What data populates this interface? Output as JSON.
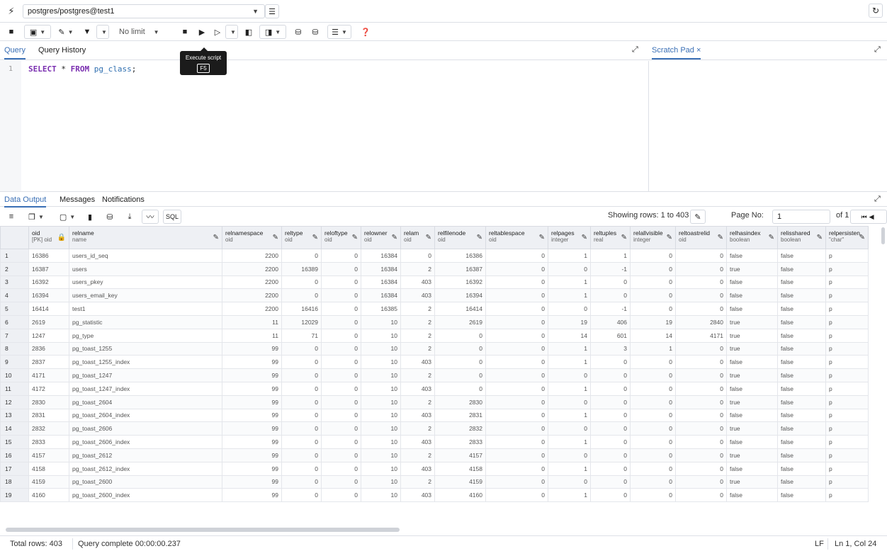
{
  "connection": {
    "value": "postgres/postgres@test1"
  },
  "toolbar": {
    "limit": "No limit",
    "sql_label": "SQL"
  },
  "tooltip": {
    "title": "Execute script",
    "key": "F5"
  },
  "query_tabs": [
    "Query",
    "Query History"
  ],
  "editor": {
    "line": "1",
    "kw1": "SELECT",
    "rest1": " * ",
    "kw2": "FROM",
    "table": "pg_class",
    "end": ";"
  },
  "scratch": {
    "tab": "Scratch Pad",
    "close": "×"
  },
  "result_tabs": [
    "Data Output",
    "Messages",
    "Notifications"
  ],
  "pager": {
    "showing": "Showing rows: 1 to 403",
    "page_no_label": "Page No:",
    "page": "1",
    "of": "of 1"
  },
  "columns": [
    {
      "name": "oid",
      "type": "[PK] oid"
    },
    {
      "name": "relname",
      "type": "name"
    },
    {
      "name": "relnamespace",
      "type": "oid"
    },
    {
      "name": "reltype",
      "type": "oid"
    },
    {
      "name": "reloftype",
      "type": "oid"
    },
    {
      "name": "relowner",
      "type": "oid"
    },
    {
      "name": "relam",
      "type": "oid"
    },
    {
      "name": "relfilenode",
      "type": "oid"
    },
    {
      "name": "reltablespace",
      "type": "oid"
    },
    {
      "name": "relpages",
      "type": "integer"
    },
    {
      "name": "reltuples",
      "type": "real"
    },
    {
      "name": "relallvisible",
      "type": "integer"
    },
    {
      "name": "reltoastrelid",
      "type": "oid"
    },
    {
      "name": "relhasindex",
      "type": "boolean"
    },
    {
      "name": "relisshared",
      "type": "boolean"
    },
    {
      "name": "relpersisten",
      "type": "\"char\""
    }
  ],
  "rows": [
    [
      "1",
      "16386",
      "users_id_seq",
      "2200",
      "0",
      "0",
      "16384",
      "0",
      "16386",
      "0",
      "1",
      "1",
      "0",
      "0",
      "false",
      "false",
      "p"
    ],
    [
      "2",
      "16387",
      "users",
      "2200",
      "16389",
      "0",
      "16384",
      "2",
      "16387",
      "0",
      "0",
      "-1",
      "0",
      "0",
      "true",
      "false",
      "p"
    ],
    [
      "3",
      "16392",
      "users_pkey",
      "2200",
      "0",
      "0",
      "16384",
      "403",
      "16392",
      "0",
      "1",
      "0",
      "0",
      "0",
      "false",
      "false",
      "p"
    ],
    [
      "4",
      "16394",
      "users_email_key",
      "2200",
      "0",
      "0",
      "16384",
      "403",
      "16394",
      "0",
      "1",
      "0",
      "0",
      "0",
      "false",
      "false",
      "p"
    ],
    [
      "5",
      "16414",
      "test1",
      "2200",
      "16416",
      "0",
      "16385",
      "2",
      "16414",
      "0",
      "0",
      "-1",
      "0",
      "0",
      "false",
      "false",
      "p"
    ],
    [
      "6",
      "2619",
      "pg_statistic",
      "11",
      "12029",
      "0",
      "10",
      "2",
      "2619",
      "0",
      "19",
      "406",
      "19",
      "2840",
      "true",
      "false",
      "p"
    ],
    [
      "7",
      "1247",
      "pg_type",
      "11",
      "71",
      "0",
      "10",
      "2",
      "0",
      "0",
      "14",
      "601",
      "14",
      "4171",
      "true",
      "false",
      "p"
    ],
    [
      "8",
      "2836",
      "pg_toast_1255",
      "99",
      "0",
      "0",
      "10",
      "2",
      "0",
      "0",
      "1",
      "3",
      "1",
      "0",
      "true",
      "false",
      "p"
    ],
    [
      "9",
      "2837",
      "pg_toast_1255_index",
      "99",
      "0",
      "0",
      "10",
      "403",
      "0",
      "0",
      "1",
      "0",
      "0",
      "0",
      "false",
      "false",
      "p"
    ],
    [
      "10",
      "4171",
      "pg_toast_1247",
      "99",
      "0",
      "0",
      "10",
      "2",
      "0",
      "0",
      "0",
      "0",
      "0",
      "0",
      "true",
      "false",
      "p"
    ],
    [
      "11",
      "4172",
      "pg_toast_1247_index",
      "99",
      "0",
      "0",
      "10",
      "403",
      "0",
      "0",
      "1",
      "0",
      "0",
      "0",
      "false",
      "false",
      "p"
    ],
    [
      "12",
      "2830",
      "pg_toast_2604",
      "99",
      "0",
      "0",
      "10",
      "2",
      "2830",
      "0",
      "0",
      "0",
      "0",
      "0",
      "true",
      "false",
      "p"
    ],
    [
      "13",
      "2831",
      "pg_toast_2604_index",
      "99",
      "0",
      "0",
      "10",
      "403",
      "2831",
      "0",
      "1",
      "0",
      "0",
      "0",
      "false",
      "false",
      "p"
    ],
    [
      "14",
      "2832",
      "pg_toast_2606",
      "99",
      "0",
      "0",
      "10",
      "2",
      "2832",
      "0",
      "0",
      "0",
      "0",
      "0",
      "true",
      "false",
      "p"
    ],
    [
      "15",
      "2833",
      "pg_toast_2606_index",
      "99",
      "0",
      "0",
      "10",
      "403",
      "2833",
      "0",
      "1",
      "0",
      "0",
      "0",
      "false",
      "false",
      "p"
    ],
    [
      "16",
      "4157",
      "pg_toast_2612",
      "99",
      "0",
      "0",
      "10",
      "2",
      "4157",
      "0",
      "0",
      "0",
      "0",
      "0",
      "true",
      "false",
      "p"
    ],
    [
      "17",
      "4158",
      "pg_toast_2612_index",
      "99",
      "0",
      "0",
      "10",
      "403",
      "4158",
      "0",
      "1",
      "0",
      "0",
      "0",
      "false",
      "false",
      "p"
    ],
    [
      "18",
      "4159",
      "pg_toast_2600",
      "99",
      "0",
      "0",
      "10",
      "2",
      "4159",
      "0",
      "0",
      "0",
      "0",
      "0",
      "true",
      "false",
      "p"
    ],
    [
      "19",
      "4160",
      "pg_toast_2600_index",
      "99",
      "0",
      "0",
      "10",
      "403",
      "4160",
      "0",
      "1",
      "0",
      "0",
      "0",
      "false",
      "false",
      "p"
    ]
  ],
  "status": {
    "total": "Total rows: 403",
    "query": "Query complete 00:00:00.237",
    "eol": "LF",
    "pos": "Ln 1, Col 24"
  }
}
